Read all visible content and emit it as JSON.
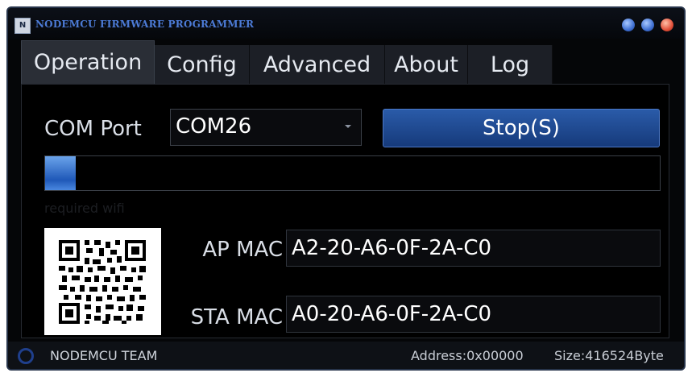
{
  "window": {
    "title": "NODEMCU FIRMWARE PROGRAMMER",
    "icon": "app-icon"
  },
  "tabs": [
    {
      "label": "Operation",
      "active": true
    },
    {
      "label": "Config",
      "active": false
    },
    {
      "label": "Advanced",
      "active": false
    },
    {
      "label": "About",
      "active": false
    },
    {
      "label": "Log",
      "active": false
    }
  ],
  "operation": {
    "com_port_label": "COM Port",
    "com_port_value": "COM26",
    "stop_button_label": "Stop(S)",
    "progress_fraction": 0.05,
    "hint_text": "required wifi",
    "ap_mac_label": "AP MAC",
    "ap_mac_value": "A2-20-A6-0F-2A-C0",
    "sta_mac_label": "STA MAC",
    "sta_mac_value": "A0-20-A6-0F-2A-C0"
  },
  "status": {
    "team": "NODEMCU TEAM",
    "address": "Address:0x00000",
    "size": "Size:416524Byte"
  },
  "colors": {
    "accent": "#1f58b8",
    "title_text": "#4c7bd6",
    "background": "#000000"
  }
}
